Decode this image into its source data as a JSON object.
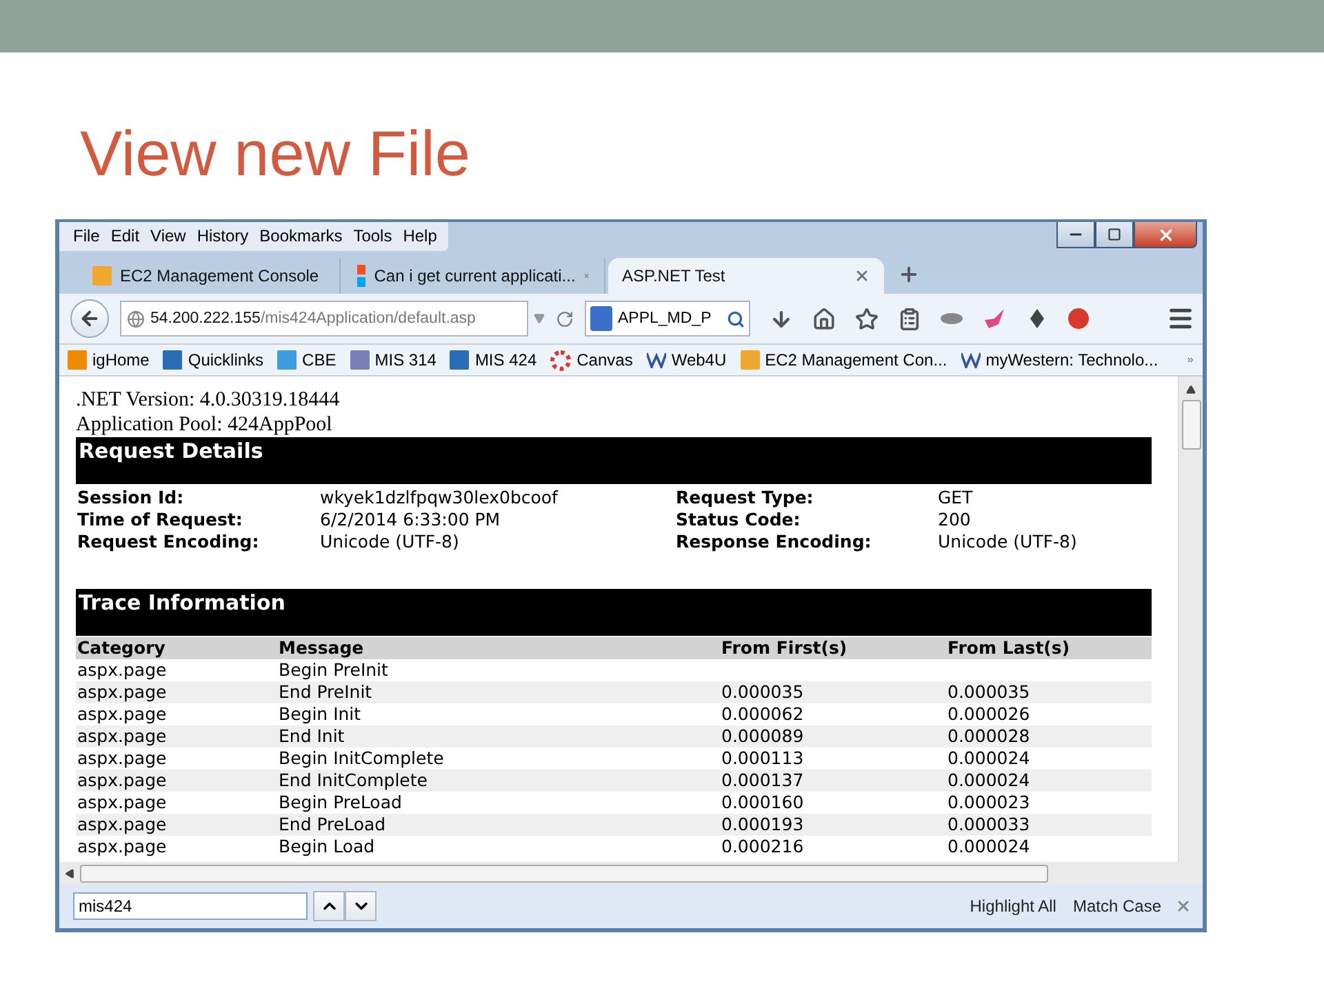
{
  "slide": {
    "title": "View new File"
  },
  "browser": {
    "menu": [
      "File",
      "Edit",
      "View",
      "History",
      "Bookmarks",
      "Tools",
      "Help"
    ],
    "tabs": [
      {
        "label": "EC2 Management Console",
        "selected": false,
        "kind": "box"
      },
      {
        "label": "Can i get current applicati...",
        "selected": false,
        "kind": "windows"
      },
      {
        "label": "ASP.NET Test",
        "selected": true,
        "kind": "plain"
      }
    ],
    "address": {
      "host": "54.200.222.155",
      "path": "/mis424Application/default.asp"
    },
    "search": {
      "value": "APPL_MD_P"
    },
    "bookmarks": [
      {
        "label": "igHome",
        "kind": "ig"
      },
      {
        "label": "Quicklinks",
        "kind": "asp"
      },
      {
        "label": "CBE",
        "kind": "cbe"
      },
      {
        "label": "MIS 314",
        "kind": "php"
      },
      {
        "label": "MIS 424",
        "kind": "asp"
      },
      {
        "label": "Canvas",
        "kind": "canvas"
      },
      {
        "label": "Web4U",
        "kind": "w"
      },
      {
        "label": "EC2 Management Con...",
        "kind": "box"
      },
      {
        "label": "myWestern: Technolo...",
        "kind": "w"
      }
    ],
    "page": {
      "info_lines": [
        ".NET Version: 4.0.30319.18444",
        "Application Pool: 424AppPool"
      ],
      "request_details": {
        "title": "Request Details",
        "fields": [
          {
            "label": "Session Id:",
            "value": "wkyek1dzlfpqw30lex0bcoof"
          },
          {
            "label": "Request Type:",
            "value": "GET"
          },
          {
            "label": "Time of Request:",
            "value": "6/2/2014 6:33:00 PM"
          },
          {
            "label": "Status Code:",
            "value": "200"
          },
          {
            "label": "Request Encoding:",
            "value": "Unicode (UTF-8)"
          },
          {
            "label": "Response Encoding:",
            "value": "Unicode (UTF-8)"
          }
        ]
      },
      "trace": {
        "title": "Trace Information",
        "columns": [
          "Category",
          "Message",
          "From First(s)",
          "From Last(s)"
        ],
        "rows": [
          [
            "aspx.page",
            "Begin PreInit",
            "",
            ""
          ],
          [
            "aspx.page",
            "End PreInit",
            "0.000035",
            "0.000035"
          ],
          [
            "aspx.page",
            "Begin Init",
            "0.000062",
            "0.000026"
          ],
          [
            "aspx.page",
            "End Init",
            "0.000089",
            "0.000028"
          ],
          [
            "aspx.page",
            "Begin InitComplete",
            "0.000113",
            "0.000024"
          ],
          [
            "aspx.page",
            "End InitComplete",
            "0.000137",
            "0.000024"
          ],
          [
            "aspx.page",
            "Begin PreLoad",
            "0.000160",
            "0.000023"
          ],
          [
            "aspx.page",
            "End PreLoad",
            "0.000193",
            "0.000033"
          ],
          [
            "aspx.page",
            "Begin Load",
            "0.000216",
            "0.000024"
          ]
        ]
      }
    },
    "find_bar": {
      "value": "mis424",
      "options": [
        "Highlight All",
        "Match Case"
      ]
    }
  }
}
